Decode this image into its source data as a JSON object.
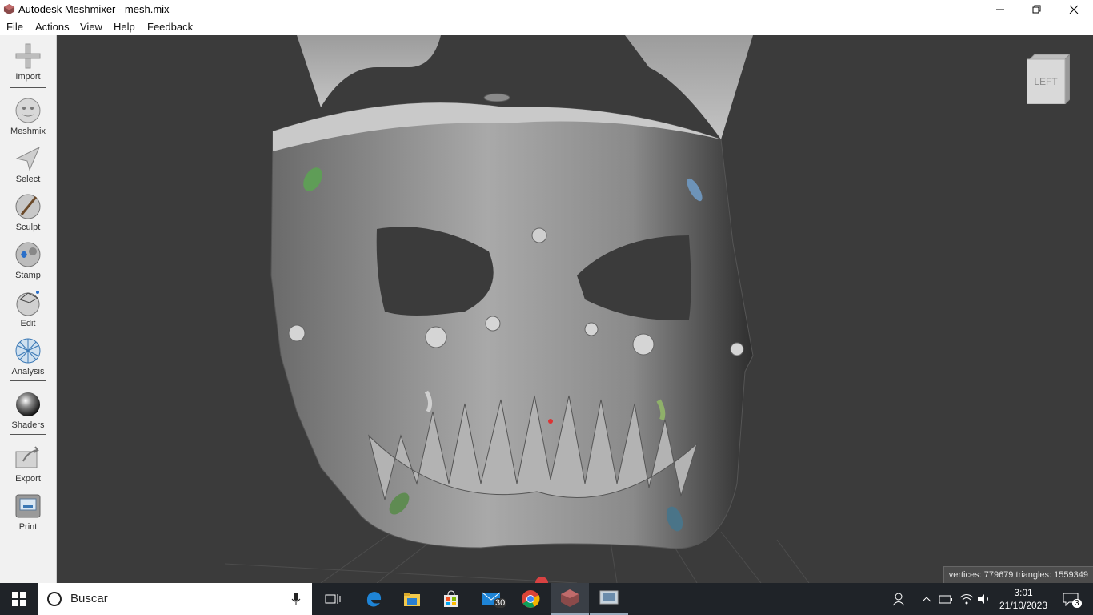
{
  "window": {
    "title": "Autodesk Meshmixer - mesh.mix",
    "minimize_icon": "minimize-icon",
    "maximize_icon": "restore-icon",
    "close_icon": "close-icon"
  },
  "menubar": {
    "items": [
      "File",
      "Actions",
      "View",
      "Help",
      "Feedback"
    ]
  },
  "sidebar": {
    "tools": [
      {
        "label": "Import",
        "icon": "import-icon"
      },
      {
        "label": "Meshmix",
        "icon": "meshmix-icon"
      },
      {
        "label": "Select",
        "icon": "select-icon"
      },
      {
        "label": "Sculpt",
        "icon": "sculpt-icon"
      },
      {
        "label": "Stamp",
        "icon": "stamp-icon"
      },
      {
        "label": "Edit",
        "icon": "edit-icon"
      },
      {
        "label": "Analysis",
        "icon": "analysis-icon"
      },
      {
        "label": "Shaders",
        "icon": "shaders-icon"
      },
      {
        "label": "Export",
        "icon": "export-icon"
      },
      {
        "label": "Print",
        "icon": "print-icon"
      }
    ]
  },
  "viewport": {
    "viewcube_label": "LEFT",
    "status": "vertices: 779679 triangles: 1559349"
  },
  "taskbar": {
    "search_placeholder": "Buscar",
    "mail_badge": "30",
    "time": "3:01",
    "date": "21/10/2023",
    "notification_count": "3"
  },
  "colors": {
    "viewport_bg": "#3b3b3b",
    "taskbar_bg": "#1f2328",
    "sidebar_bg": "#f1f1f1"
  }
}
